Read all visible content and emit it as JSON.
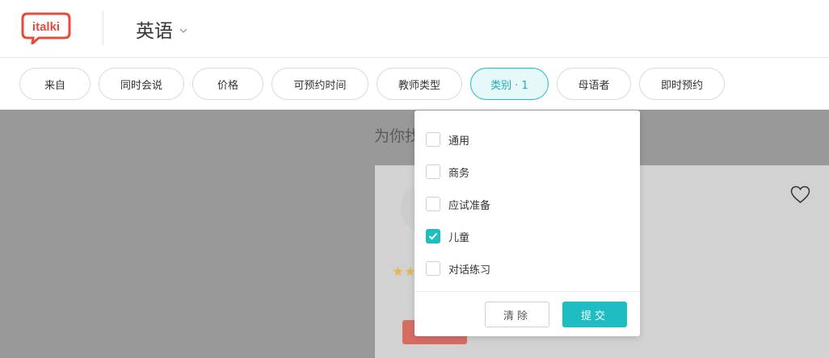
{
  "header": {
    "logo_text": "italki",
    "language": "英语"
  },
  "filters": [
    {
      "label": "来自"
    },
    {
      "label": "同时会说"
    },
    {
      "label": "价格"
    },
    {
      "label": "可预约时间"
    },
    {
      "label": "教师类型"
    },
    {
      "label": "类别 · 1",
      "active": true
    },
    {
      "label": "母语者"
    },
    {
      "label": "即时预约"
    }
  ],
  "content": {
    "section_title": "为你找"
  },
  "category_dropdown": {
    "options": [
      {
        "label": "通用",
        "checked": false
      },
      {
        "label": "商务",
        "checked": false
      },
      {
        "label": "应试准备",
        "checked": false
      },
      {
        "label": "儿童",
        "checked": true
      },
      {
        "label": "对话练习",
        "checked": false
      }
    ],
    "clear_label": "清除",
    "submit_label": "提交"
  },
  "colors": {
    "brand_red": "#e64b3c",
    "accent_teal": "#1fbcc2",
    "star_gold": "#f0a800"
  }
}
